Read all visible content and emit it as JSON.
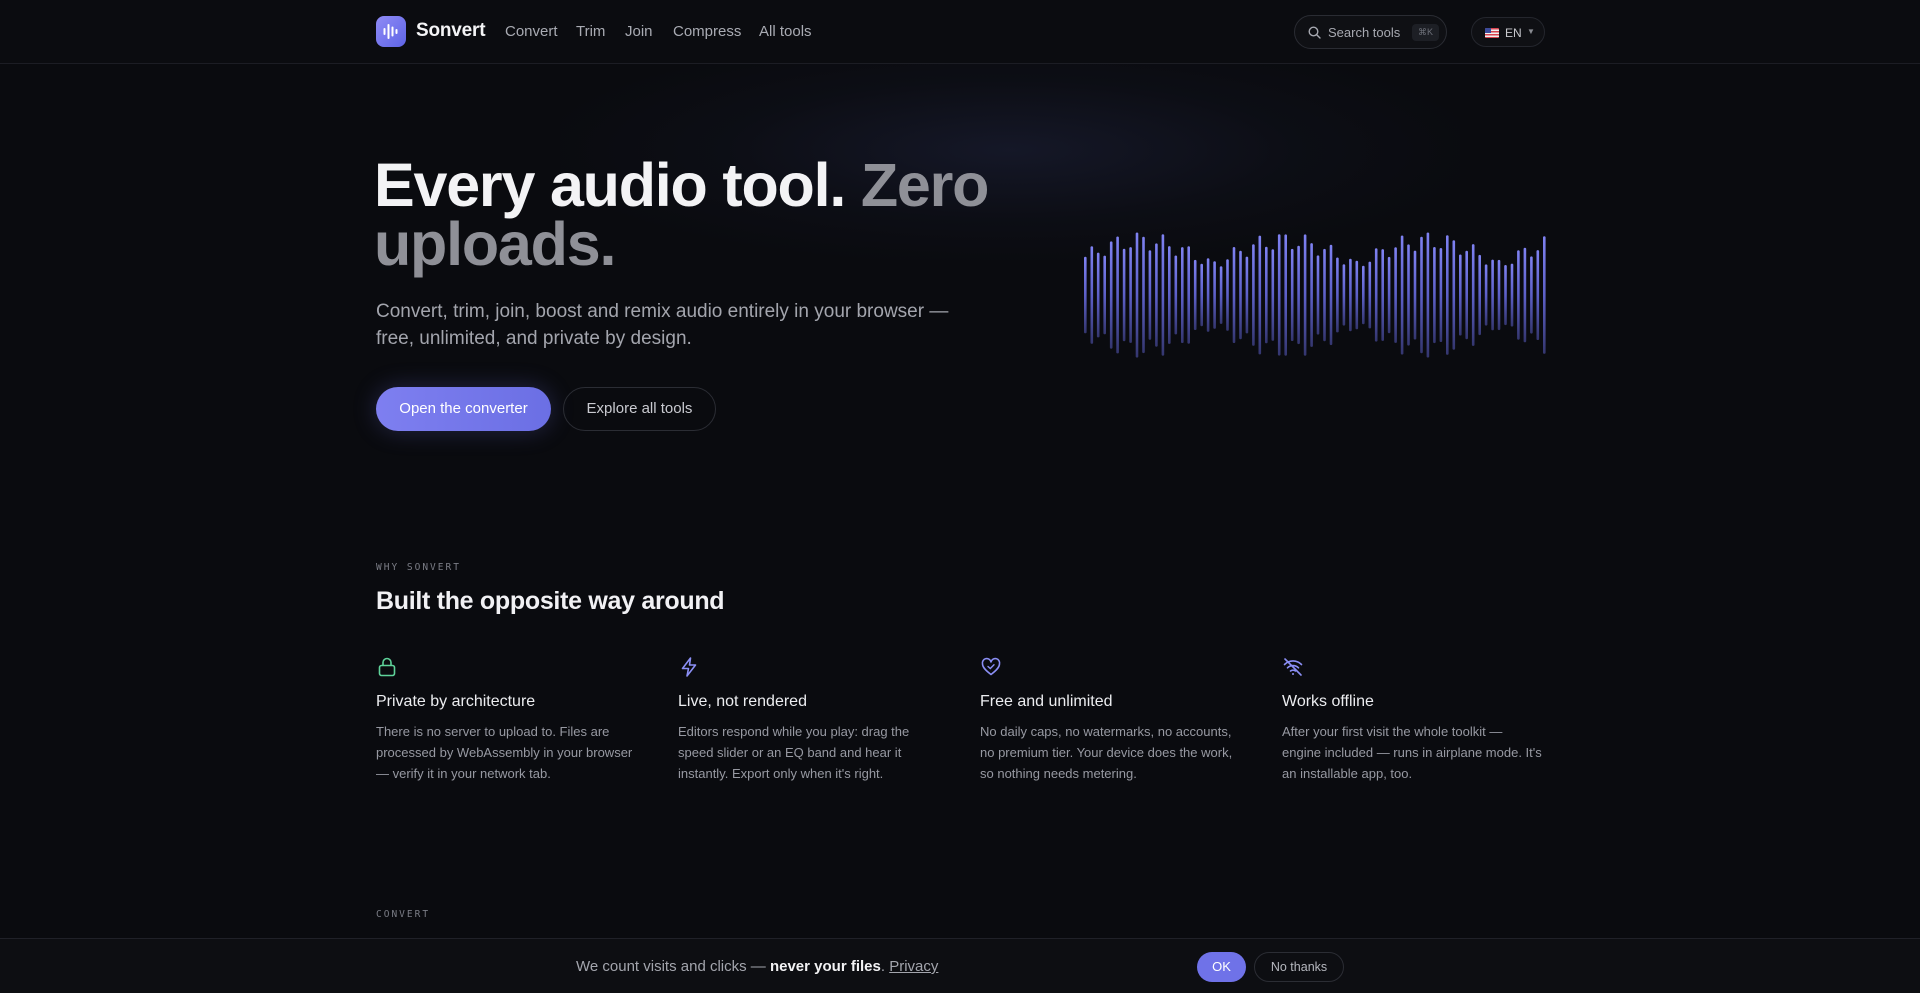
{
  "nav": {
    "brand": "Sonvert",
    "links": [
      "Convert",
      "Trim",
      "Join",
      "Compress",
      "All tools"
    ],
    "search_placeholder": "Search tools",
    "search_shortcut": "⌘K",
    "language": "EN",
    "logo_icon": "waveform-icon",
    "search_icon": "search-icon",
    "flag_icon": "us-flag-icon"
  },
  "hero": {
    "title_main": "Every audio tool. ",
    "title_dim": "Zero uploads.",
    "subtitle": "Convert, trim, join, boost and remix audio entirely in your browser — free, unlimited, and private by design.",
    "primary_cta": "Open the converter",
    "secondary_cta": "Explore all tools"
  },
  "why": {
    "eyebrow": "WHY SONVERT",
    "heading": "Built the opposite way around",
    "features": [
      {
        "icon": "lock-icon",
        "title": "Private by architecture",
        "body": "There is no server to upload to. Files are processed by WebAssembly in your browser — verify it in your network tab."
      },
      {
        "icon": "lightning-icon",
        "title": "Live, not rendered",
        "body": "Editors respond while you play: drag the speed slider or an EQ band and hear it instantly. Export only when it's right."
      },
      {
        "icon": "heart-icon",
        "title": "Free and unlimited",
        "body": "No daily caps, no watermarks, no accounts, no premium tier. Your device does the work, so nothing needs metering."
      },
      {
        "icon": "wifi-off-icon",
        "title": "Works offline",
        "body": "After your first visit the whole toolkit — engine included — runs in airplane mode. It's an installable app, too."
      }
    ]
  },
  "next_section": {
    "eyebrow": "CONVERT"
  },
  "cookie": {
    "text_before": "We count visits and clicks — ",
    "text_bold": "never your files",
    "text_after": ". ",
    "privacy_link": "Privacy",
    "ok": "OK",
    "decline": "No thanks"
  },
  "colors": {
    "background": "#0a0b0f",
    "accent": "#6f72e8",
    "green_icon": "#5fd39a",
    "purple_icon": "#8b8ff5"
  }
}
